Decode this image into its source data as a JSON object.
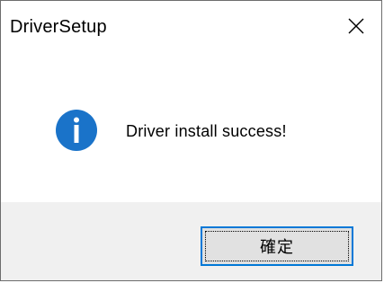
{
  "window": {
    "title": "DriverSetup",
    "close_icon": "close-icon"
  },
  "message": {
    "icon": "info-icon",
    "text": "Driver install success!"
  },
  "buttons": {
    "ok_label": "確定"
  },
  "colors": {
    "accent": "#0078d7",
    "footer_bg": "#f0f0f0",
    "button_bg": "#e1e1e1",
    "icon_bg": "#1a73c9"
  }
}
